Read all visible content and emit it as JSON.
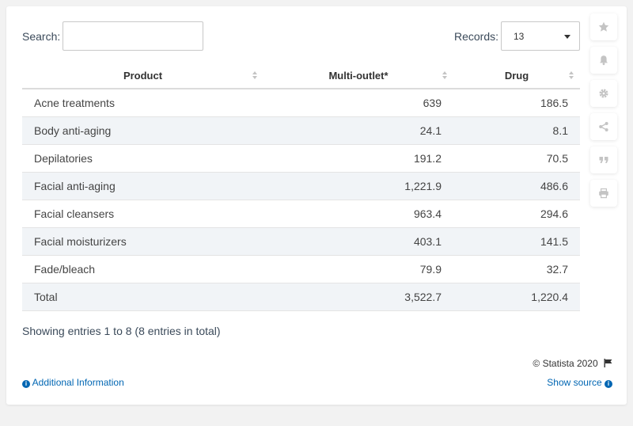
{
  "controls": {
    "search_label": "Search:",
    "search_value": "",
    "records_label": "Records:",
    "records_value": "13"
  },
  "table": {
    "headers": [
      "Product",
      "Multi-outlet*",
      "Drug"
    ],
    "rows": [
      [
        "Acne treatments",
        "639",
        "186.5"
      ],
      [
        "Body anti-aging",
        "24.1",
        "8.1"
      ],
      [
        "Depilatories",
        "191.2",
        "70.5"
      ],
      [
        "Facial anti-aging",
        "1,221.9",
        "486.6"
      ],
      [
        "Facial cleansers",
        "963.4",
        "294.6"
      ],
      [
        "Facial moisturizers",
        "403.1",
        "141.5"
      ],
      [
        "Fade/bleach",
        "79.9",
        "32.7"
      ],
      [
        "Total",
        "3,522.7",
        "1,220.4"
      ]
    ]
  },
  "footer": {
    "entries_text": "Showing entries 1 to 8 (8 entries in total)",
    "copyright": "© Statista 2020",
    "additional_info": "Additional Information",
    "show_source": "Show source"
  },
  "sidebar_icons": [
    "star-icon",
    "bell-icon",
    "gear-icon",
    "share-icon",
    "quote-icon",
    "print-icon"
  ],
  "colors": {
    "link": "#0066b3",
    "row_stripe": "#f1f4f7",
    "icon": "#c4c4c4"
  },
  "chart_data": {
    "type": "table",
    "columns": [
      "Product",
      "Multi-outlet*",
      "Drug"
    ],
    "rows": [
      {
        "product": "Acne treatments",
        "multi_outlet": 639,
        "drug": 186.5
      },
      {
        "product": "Body anti-aging",
        "multi_outlet": 24.1,
        "drug": 8.1
      },
      {
        "product": "Depilatories",
        "multi_outlet": 191.2,
        "drug": 70.5
      },
      {
        "product": "Facial anti-aging",
        "multi_outlet": 1221.9,
        "drug": 486.6
      },
      {
        "product": "Facial cleansers",
        "multi_outlet": 963.4,
        "drug": 294.6
      },
      {
        "product": "Facial moisturizers",
        "multi_outlet": 403.1,
        "drug": 141.5
      },
      {
        "product": "Fade/bleach",
        "multi_outlet": 79.9,
        "drug": 32.7
      },
      {
        "product": "Total",
        "multi_outlet": 3522.7,
        "drug": 1220.4
      }
    ]
  }
}
